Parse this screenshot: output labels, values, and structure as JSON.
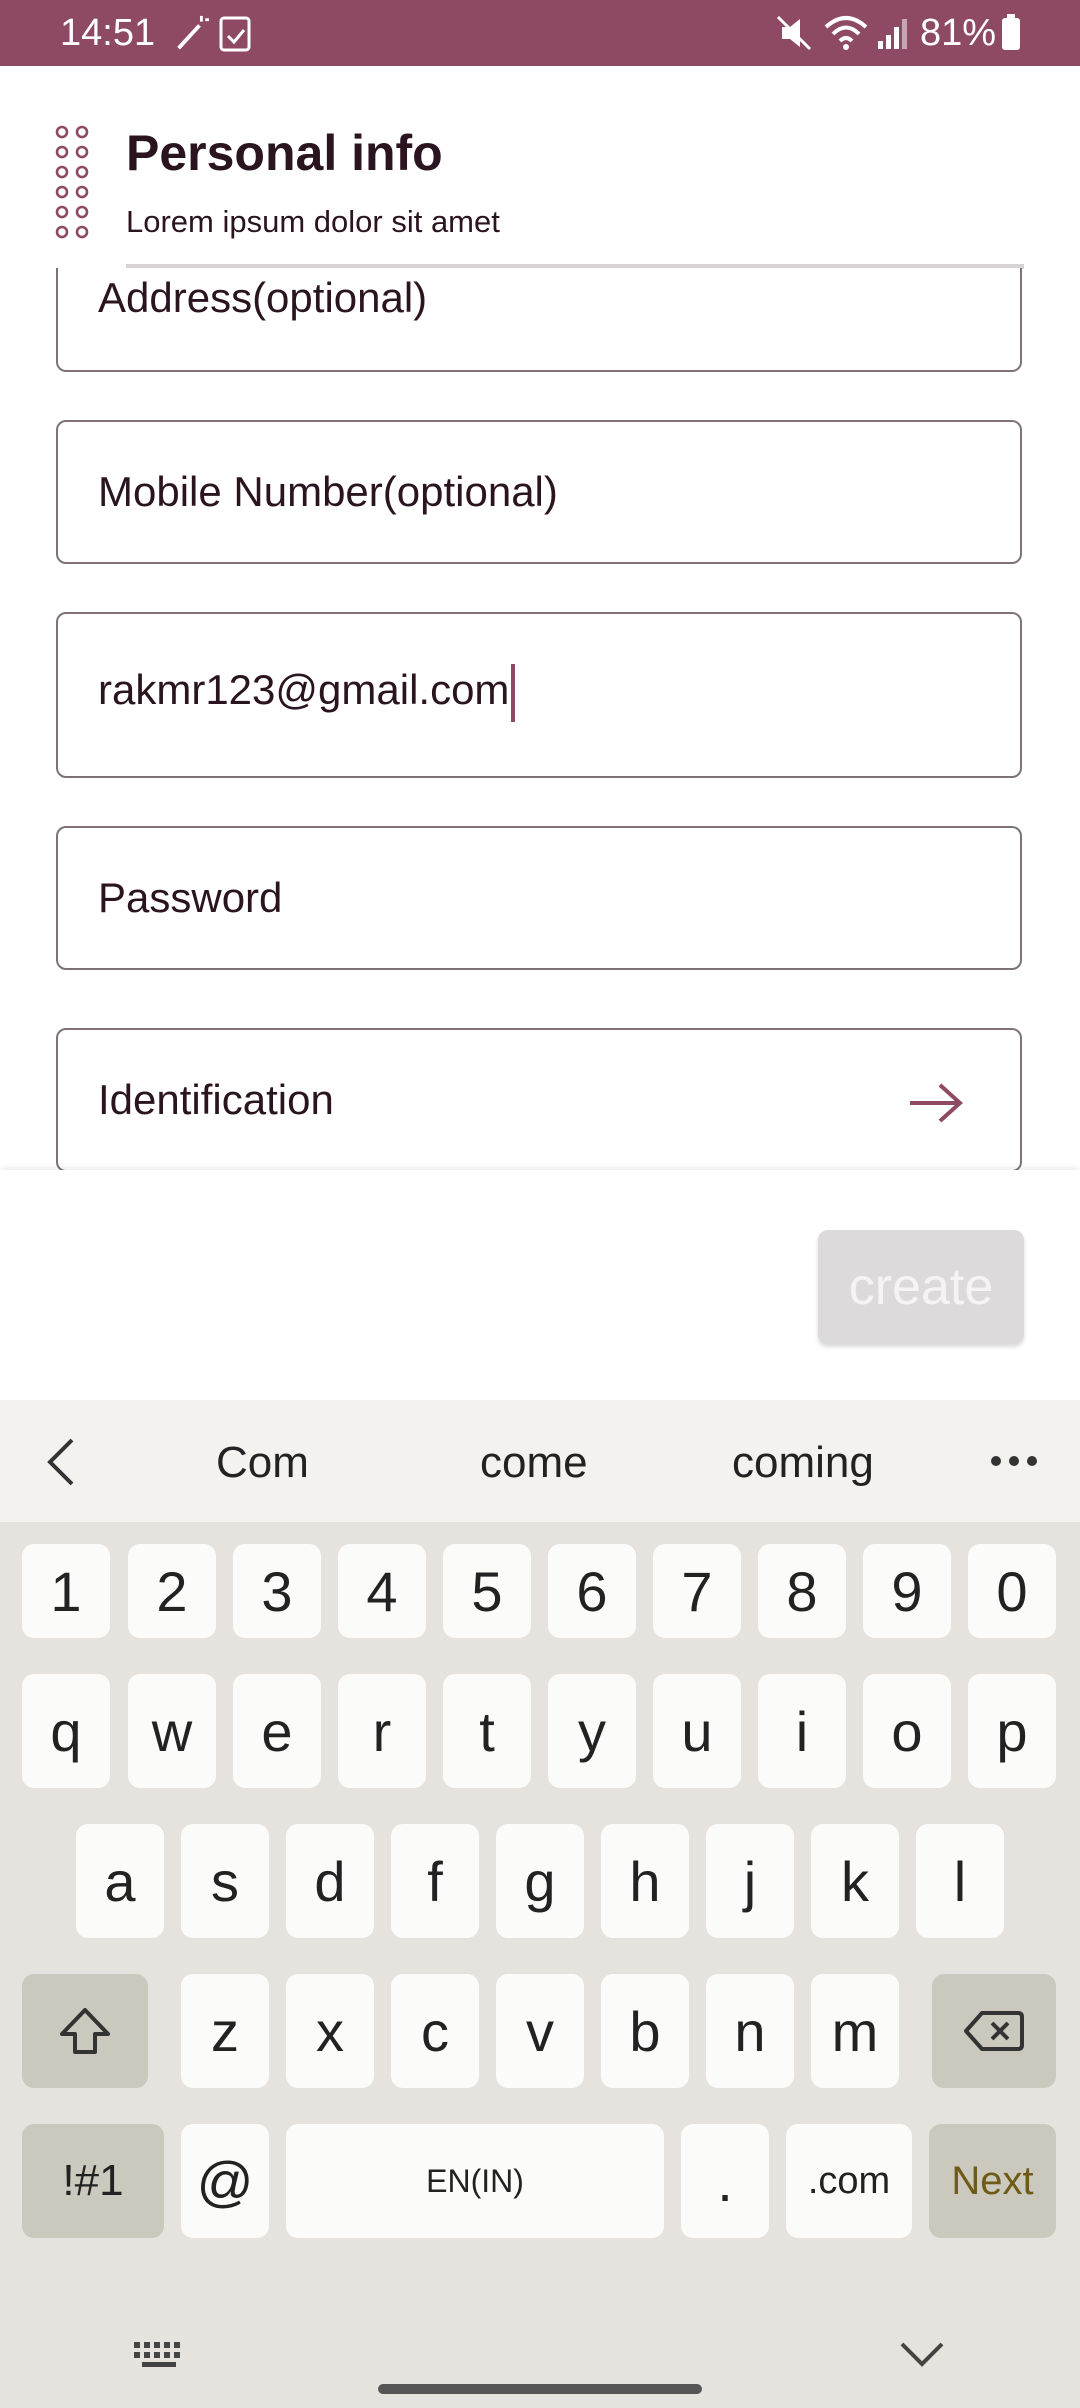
{
  "status_bar": {
    "time": "14:51",
    "battery": "81%"
  },
  "header": {
    "title": "Personal info",
    "subtitle": "Lorem ipsum dolor sit amet"
  },
  "form": {
    "address_label": "Address(optional)",
    "mobile_label": "Mobile Number(optional)",
    "email_value": "rakmr123@gmail.com",
    "password_label": "Password",
    "identification_label": "Identification",
    "create_label": "create"
  },
  "keyboard": {
    "suggestions": [
      "Com",
      "come",
      "coming"
    ],
    "row_numbers": [
      "1",
      "2",
      "3",
      "4",
      "5",
      "6",
      "7",
      "8",
      "9",
      "0"
    ],
    "row1": [
      "q",
      "w",
      "e",
      "r",
      "t",
      "y",
      "u",
      "i",
      "o",
      "p"
    ],
    "row2": [
      "a",
      "s",
      "d",
      "f",
      "g",
      "h",
      "j",
      "k",
      "l"
    ],
    "row3": [
      "z",
      "x",
      "c",
      "v",
      "b",
      "n",
      "m"
    ],
    "symbols_label": "!#1",
    "at_label": "@",
    "space_label": "EN(IN)",
    "period_label": ".",
    "dotcom_label": ".com",
    "next_label": "Next"
  },
  "colors": {
    "accent": "#8e4a64",
    "keyboard_bg": "#e6e3de"
  }
}
